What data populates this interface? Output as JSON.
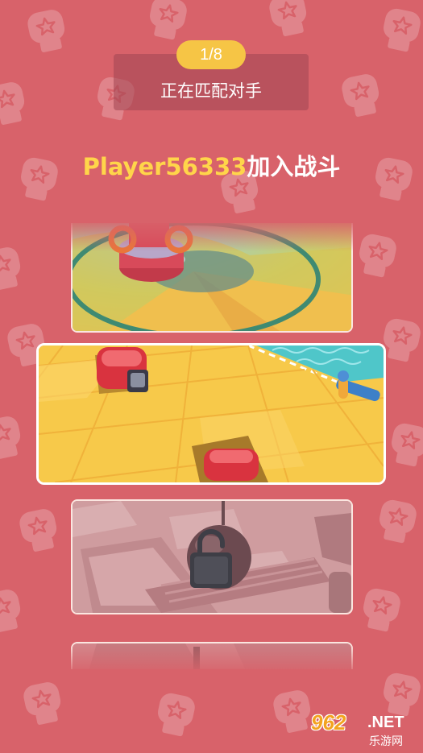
{
  "header": {
    "counter": "1/8",
    "status": "正在匹配对手"
  },
  "announcement": {
    "player": "Player56333",
    "suffix": "加入战斗"
  },
  "maps": [
    {
      "id": "arena",
      "locked": false,
      "selected": false
    },
    {
      "id": "tiles",
      "locked": false,
      "selected": true
    },
    {
      "id": "factory",
      "locked": true,
      "selected": false
    },
    {
      "id": "hidden",
      "locked": false,
      "selected": false
    }
  ],
  "watermark": {
    "logo": "962",
    "net": ".NET",
    "sub": "乐游网"
  },
  "colors": {
    "background": "#d8626a",
    "accent": "#f6c545",
    "player_name": "#ffd54a"
  },
  "icons": [
    "boxing-glove-icon",
    "lock-icon"
  ]
}
